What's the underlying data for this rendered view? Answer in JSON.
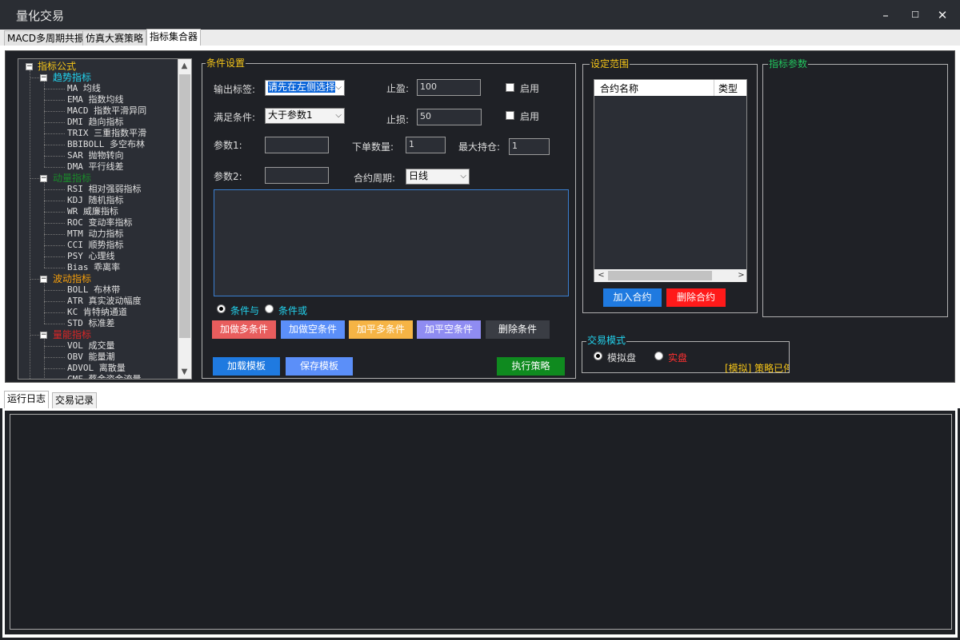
{
  "window": {
    "title": "量化交易",
    "minimize": "–",
    "maximize": "☐",
    "close": "✕"
  },
  "tabs": [
    "MACD多周期共振",
    "仿真大赛策略",
    "指标集合器"
  ],
  "tree": {
    "root": "指标公式",
    "groups": [
      {
        "label": "趋势指标",
        "color": "#22d3ee",
        "items": [
          "MA 均线",
          "EMA 指数均线",
          "MACD 指数平滑异同",
          "DMI 趋向指标",
          "TRIX 三重指数平滑",
          "BBIBOLL 多空布林",
          "SAR 抛物转向",
          "DMA 平行线差"
        ]
      },
      {
        "label": "动量指标",
        "color": "#1a8a2a",
        "items": [
          "RSI 相对强弱指标",
          "KDJ 随机指标",
          "WR 威廉指标",
          "ROC 变动率指标",
          "MTM 动力指标",
          "CCI 顺势指标",
          "PSY 心理线",
          "Bias 乖离率"
        ]
      },
      {
        "label": "波动指标",
        "color": "#f59e0b",
        "items": [
          "BOLL 布林带",
          "ATR 真实波动幅度",
          "KC 肯特纳通道",
          "STD 标准差"
        ]
      },
      {
        "label": "量能指标",
        "color": "#dc2626",
        "items": [
          "VOL 成交量",
          "OBV 能量潮",
          "ADVOL 离散量",
          "CMF 蔡金资金流量"
        ]
      }
    ],
    "scroll_up": "▲",
    "scroll_down": "▼"
  },
  "condition": {
    "group_label": "条件设置",
    "output_label": "输出标签:",
    "output_value": "请先在左侧选择",
    "satisfy_label": "满足条件:",
    "satisfy_value": "大于参数1",
    "take_profit_label": "止盈:",
    "take_profit_value": "100",
    "stop_loss_label": "止损:",
    "stop_loss_value": "50",
    "enable1": "启用",
    "enable2": "启用",
    "param1_label": "参数1:",
    "param2_label": "参数2:",
    "order_qty_label": "下单数量:",
    "order_qty_value": "1",
    "max_pos_label": "最大持仓:",
    "max_pos_value": "1",
    "period_label": "合约周期:",
    "period_value": "日线",
    "radio_and": "条件与",
    "radio_or": "条件或",
    "buttons": {
      "add_long": "加做多条件",
      "add_short": "加做空条件",
      "close_long": "加平多条件",
      "close_short": "加平空条件",
      "delete": "删除条件",
      "load": "加载模板",
      "save": "保存模板",
      "execute": "执行策略"
    }
  },
  "range": {
    "group_label": "设定范围",
    "col_name": "合约名称",
    "col_type": "类型",
    "add": "加入合约",
    "remove": "删除合约",
    "scroll_left": "<",
    "scroll_right": ">"
  },
  "params": {
    "group_label": "指标参数"
  },
  "mode": {
    "group_label": "交易模式",
    "sim": "模拟盘",
    "real": "实盘",
    "status": "[模拟] 策略已停"
  },
  "bottom_tabs": [
    "运行日志",
    "交易记录"
  ],
  "colors": {
    "accent_yellow": "#f5c518",
    "green_label": "#22c55e",
    "cyan": "#22d3ee"
  }
}
